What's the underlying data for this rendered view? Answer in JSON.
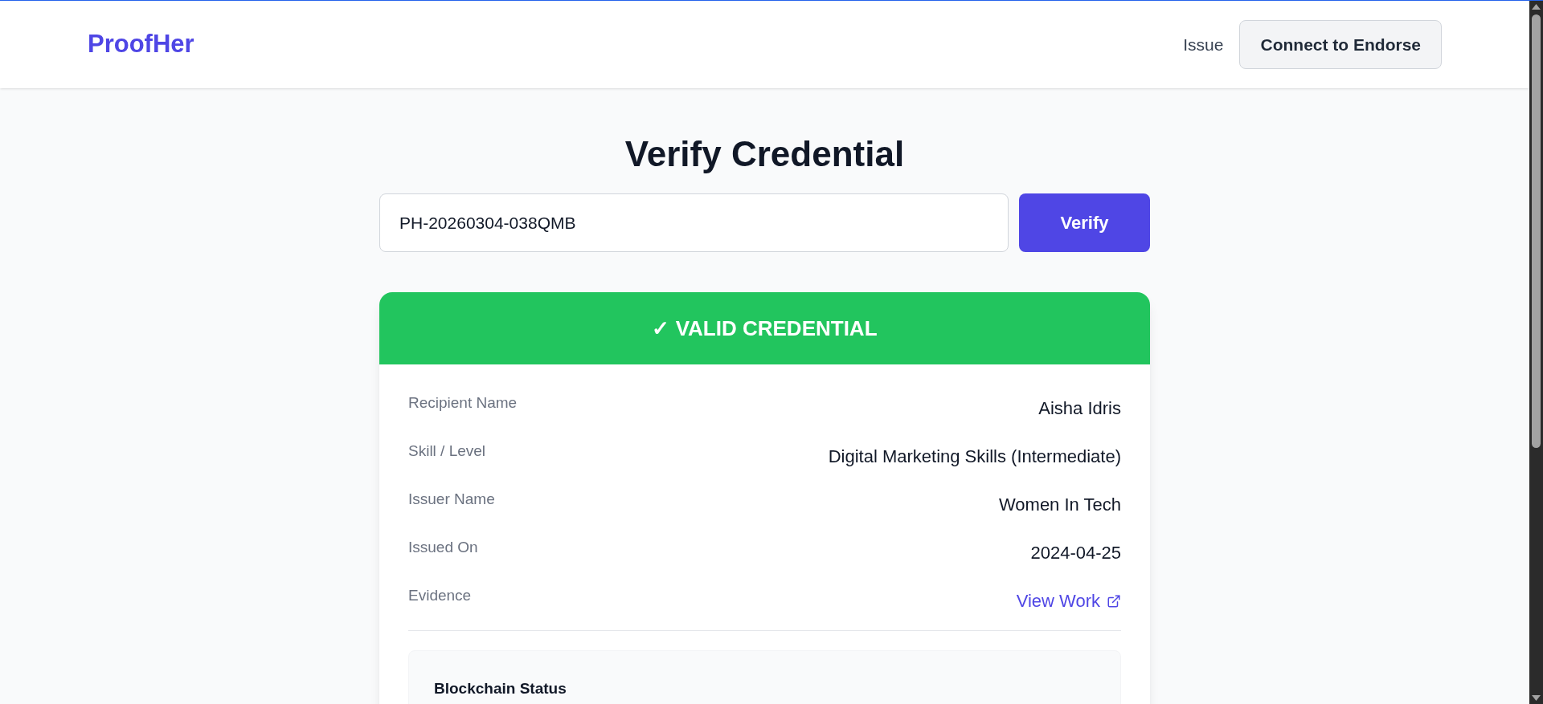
{
  "header": {
    "logo": "ProofHer",
    "nav_link": "Issue",
    "connect_button": "Connect to Endorse"
  },
  "title": "Verify Credential",
  "search": {
    "value": "PH-20260304-038QMB",
    "button": "Verify"
  },
  "result": {
    "valid": true,
    "banner": "✓ VALID CREDENTIAL",
    "fields": [
      {
        "label": "Recipient Name",
        "value": "Aisha Idris",
        "kind": "text"
      },
      {
        "label": "Skill / Level",
        "value": "Digital Marketing Skills (Intermediate)",
        "kind": "text"
      },
      {
        "label": "Issuer Name",
        "value": "Women In Tech",
        "kind": "text"
      },
      {
        "label": "Issued On",
        "value": "2024-04-25",
        "kind": "text"
      },
      {
        "label": "Evidence",
        "value": "View Work",
        "kind": "link"
      }
    ],
    "blockchain": {
      "title": "Blockchain Status"
    }
  }
}
